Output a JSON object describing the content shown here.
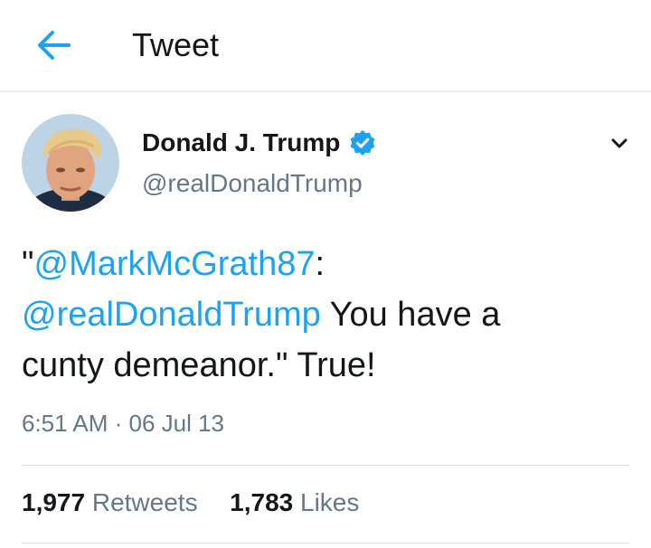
{
  "header": {
    "title": "Tweet",
    "back_icon": "arrow-left-icon"
  },
  "user": {
    "display_name": "Donald J. Trump",
    "handle": "@realDonaldTrump",
    "verified_icon": "verified-badge-icon"
  },
  "tweet": {
    "quote_open": "\"",
    "mention_1": "@MarkMcGrath87",
    "colon": ":",
    "mention_2": "@realDonaldTrump",
    "text_1": " You have a",
    "text_2": "cunty demeanor.\"  True!",
    "timestamp": "6:51 AM · 06 Jul 13"
  },
  "stats": {
    "retweets_count": "1,977",
    "retweets_label": "Retweets",
    "likes_count": "1,783",
    "likes_label": "Likes"
  },
  "colors": {
    "accent": "#1da1f2",
    "text": "#14171a",
    "muted": "#657786"
  }
}
